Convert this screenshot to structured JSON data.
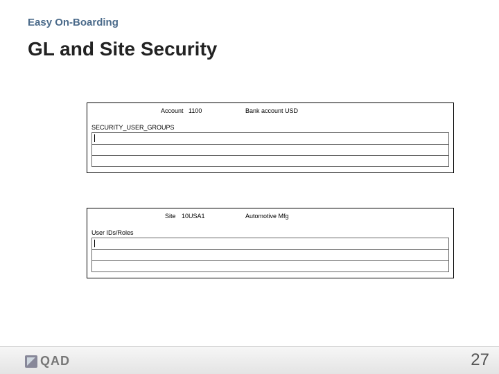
{
  "section_label": "Easy On-Boarding",
  "title": "GL and Site Security",
  "panel_top": {
    "meta_label": "Account",
    "meta_value": "1100",
    "meta_desc": "Bank account USD",
    "group_label": "SECURITY_USER_GROUPS"
  },
  "panel_bottom": {
    "meta_label": "Site",
    "meta_value": "10USA1",
    "meta_desc": "Automotive Mfg",
    "group_label": "User IDs/Roles"
  },
  "logo_text": "QAD",
  "page_number": "27"
}
